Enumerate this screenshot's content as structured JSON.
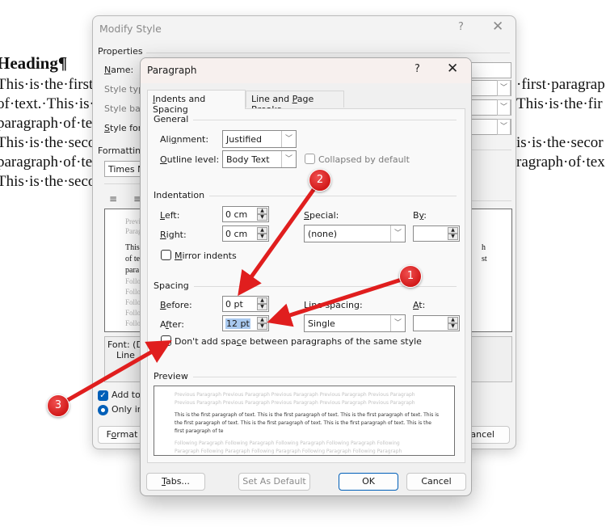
{
  "document": {
    "heading": "Heading¶",
    "lines_left": [
      "This·is·the·first·",
      "of·text.·This·is·",
      "paragraph·of·tex",
      "This·is·the·seco",
      "paragraph·of·te",
      "This·is·the·seco"
    ],
    "lines_right": [
      "·first·paragrap",
      "This·is·the·fir",
      "",
      "is·is·the·secor",
      "ragraph·of·tex"
    ]
  },
  "modify_style": {
    "title": "Modify Style",
    "help": "?",
    "close": "✕",
    "properties_label": "Properties",
    "name_label": "Name:",
    "style_type_label": "Style typ",
    "style_based_label": "Style bas",
    "style_following_label": "Style for",
    "formatting_label": "Formatting",
    "font_value": "Times N",
    "preview": {
      "prev": [
        "Previ",
        "Parag"
      ],
      "body": [
        "This",
        "of te",
        "para"
      ],
      "follow": [
        "Follo",
        "Follo",
        "Follo",
        "Follo",
        "Follo"
      ],
      "right": [
        "h",
        "st"
      ]
    },
    "description": [
      "Font: (D",
      "Line"
    ],
    "add_to_gallery_label": "Add to",
    "only_in_doc_label": "Only in",
    "format_button": "Format",
    "cancel_button": "ancel"
  },
  "paragraph": {
    "title": "Paragraph",
    "help": "?",
    "close": "✕",
    "tabs": [
      {
        "label": "Indents and Spacing",
        "active": true
      },
      {
        "label": "Line and Page Breaks",
        "active": false
      }
    ],
    "general": {
      "title": "General",
      "alignment_label": "Alignment:",
      "alignment_value": "Justified",
      "outline_label": "Outline level:",
      "outline_value": "Body Text",
      "collapsed_label": "Collapsed by default",
      "collapsed_checked": false
    },
    "indentation": {
      "title": "Indentation",
      "left_label": "Left:",
      "left_value": "0 cm",
      "right_label": "Right:",
      "right_value": "0 cm",
      "special_label": "Special:",
      "special_value": "(none)",
      "by_label": "By:",
      "by_value": "",
      "mirror_label": "Mirror indents",
      "mirror_checked": false
    },
    "spacing": {
      "title": "Spacing",
      "before_label": "Before:",
      "before_value": "0 pt",
      "after_label": "After:",
      "after_value": "12 pt",
      "line_spacing_label": "Line spacing:",
      "line_spacing_value": "Single",
      "at_label": "At:",
      "at_value": "",
      "dont_add_label": "Don't add space between paragraphs of the same style",
      "dont_add_checked": false
    },
    "preview": {
      "title": "Preview",
      "previous": [
        "Previous Paragraph Previous Paragraph Previous Paragraph Previous Paragraph Previous Paragraph",
        "Previous Paragraph Previous Paragraph Previous Paragraph Previous Paragraph Previous Paragraph"
      ],
      "body": [
        "This is the first paragraph of text. This is the first paragraph of text. This is the first paragraph of text. This is",
        "the first paragraph of text. This is the first paragraph of text. This is the first paragraph of text. This is the",
        "first paragraph of te"
      ],
      "following": [
        "Following Paragraph Following Paragraph Following Paragraph Following Paragraph Following",
        "Paragraph Following Paragraph Following Paragraph Following Paragraph Following Paragraph"
      ]
    },
    "buttons": {
      "tabs": "Tabs...",
      "set_default": "Set As Default",
      "ok": "OK",
      "cancel": "Cancel"
    }
  },
  "annotations": [
    {
      "number": "1",
      "target": "after-spacing-spinner"
    },
    {
      "number": "2",
      "target": "before-spacing-field"
    },
    {
      "number": "3",
      "target": "dont-add-space-checkbox"
    }
  ],
  "colors": {
    "annotation_red": "#e01e1e",
    "accent_blue": "#005fb8",
    "selection": "#a9c9ef"
  }
}
